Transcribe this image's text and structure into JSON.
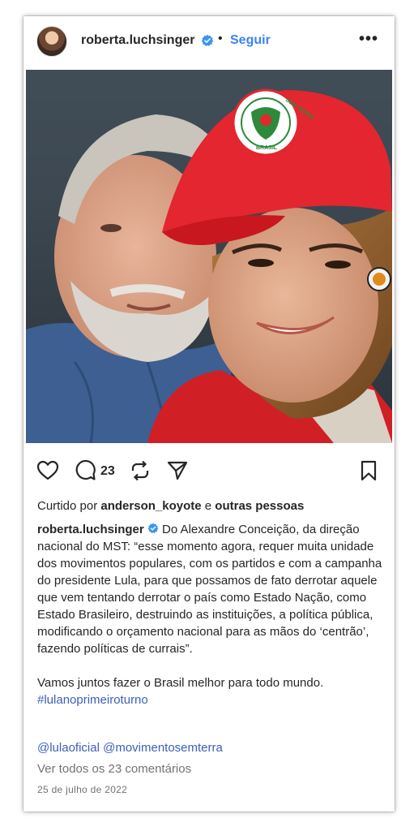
{
  "post": {
    "username": "roberta.luchsinger",
    "separator": "•",
    "follow_label": "Seguir",
    "more_label": "•••",
    "comment_count": "23",
    "likes_prefix": "Curtido por",
    "likes_user": "anderson_koyote",
    "likes_joiner": "e",
    "likes_others": "outras pessoas",
    "caption_user": "roberta.luchsinger",
    "caption_text": "Do Alexandre Conceição, da direção nacional do MST: “esse momento agora, requer muita unidade dos movimentos populares, com os partidos e com a campanha do presidente Lula, para que possamos de fato derrotar aquele que vem tentando derrotar o país como Estado Nação, como Estado Brasileiro, destruindo as instituições, a política pública, modificando o orçamento nacional para as mãos do ‘centrão’, fazendo políticas de currais”.",
    "caption_line2": "Vamos juntos fazer o Brasil melhor para todo mundo.",
    "hashtag": "#lulanoprimeiroturno",
    "mentions": "@lulaoficial @movimentosemterra",
    "view_comments": "Ver todos os 23 comentários",
    "date": "25 de julho de 2022",
    "cap_logo_text": "SEM TERRA",
    "cap_logo_sub": "BRASIL"
  },
  "colors": {
    "accent": "#3b82f6",
    "link": "#3b5fb8",
    "muted": "#737373",
    "cap_red": "#e3262f",
    "verified_blue": "#3897f0"
  },
  "icons": [
    "verified-icon",
    "more-icon",
    "heart-icon",
    "comment-icon",
    "repost-icon",
    "share-icon",
    "save-icon"
  ]
}
